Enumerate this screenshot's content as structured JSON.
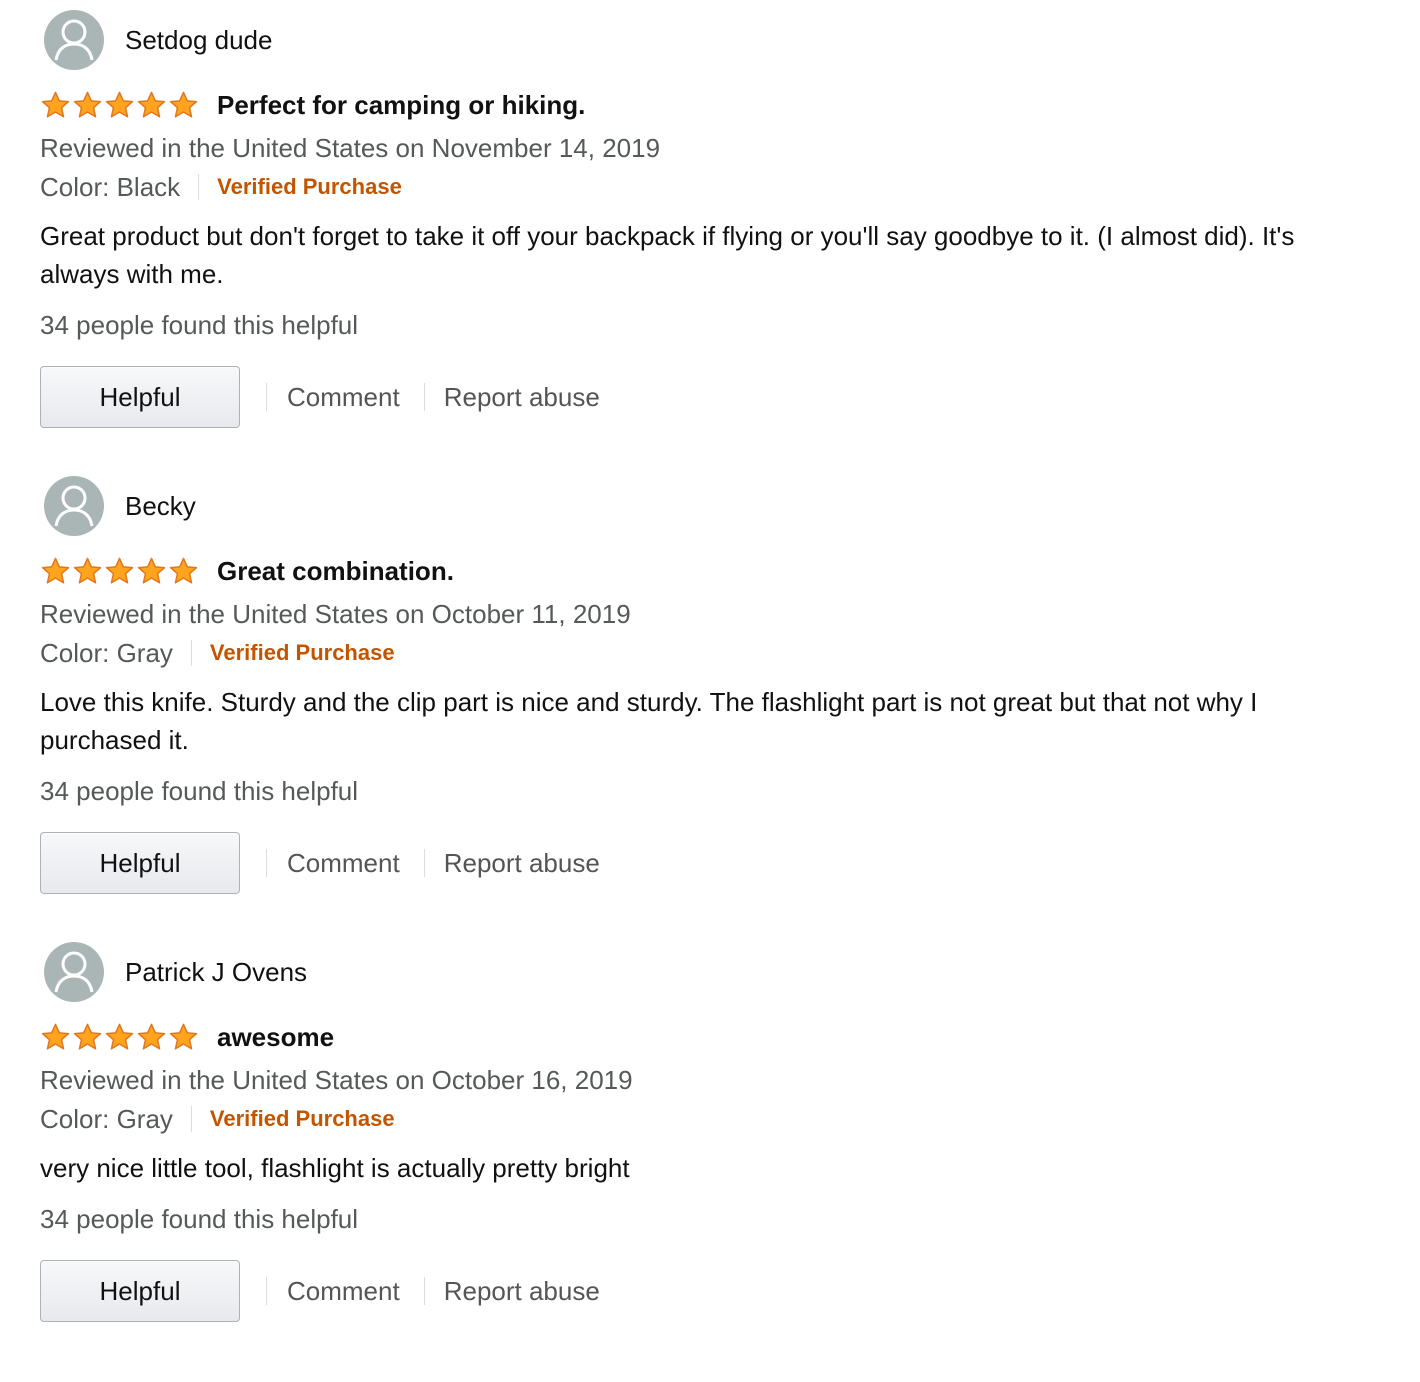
{
  "colors": {
    "star_fill": "#FFA41C",
    "star_stroke": "#DE7921",
    "verified": "#C45500",
    "secondary_text": "#565959",
    "avatar_bg": "#AAB6B5"
  },
  "reviews": [
    {
      "profile_name": "Setdog dude",
      "rating": 5,
      "title": "Perfect for camping or hiking.",
      "date_text": "Reviewed in the United States on November 14, 2019",
      "format": "Color: Black",
      "verified_label": "Verified Purchase",
      "body": "Great product but don't forget to take it off your backpack if flying or you'll say goodbye to it. (I almost did). It's always with me.",
      "helpful_count": "34 people found this helpful",
      "helpful_button": "Helpful",
      "comment_link": "Comment",
      "report_link": "Report abuse"
    },
    {
      "profile_name": "Becky",
      "rating": 5,
      "title": "Great combination.",
      "date_text": "Reviewed in the United States on October 11, 2019",
      "format": "Color: Gray",
      "verified_label": "Verified Purchase",
      "body": "Love this knife. Sturdy and the clip part is nice and sturdy. The flashlight part is not great but that not why I purchased it.",
      "helpful_count": "34 people found this helpful",
      "helpful_button": "Helpful",
      "comment_link": "Comment",
      "report_link": "Report abuse"
    },
    {
      "profile_name": "Patrick J Ovens",
      "rating": 5,
      "title": "awesome",
      "date_text": "Reviewed in the United States on October 16, 2019",
      "format": "Color: Gray",
      "verified_label": "Verified Purchase",
      "body": "very nice little tool, flashlight is actually pretty bright",
      "helpful_count": "34 people found this helpful",
      "helpful_button": "Helpful",
      "comment_link": "Comment",
      "report_link": "Report abuse"
    }
  ]
}
